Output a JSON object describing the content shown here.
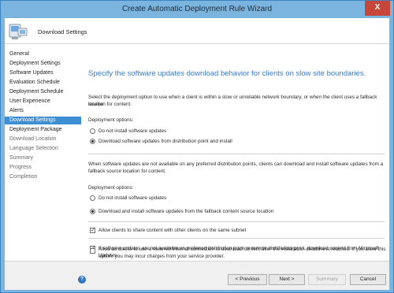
{
  "window": {
    "title": "Create Automatic Deployment Rule Wizard",
    "close_label": "X"
  },
  "header": {
    "title": "Download Settings",
    "icon": "computer-wizard-icon"
  },
  "nav": {
    "items": [
      {
        "label": "General",
        "state": "done"
      },
      {
        "label": "Deployment Settings",
        "state": "done"
      },
      {
        "label": "Software Updates",
        "state": "done"
      },
      {
        "label": "Evaluation Schedule",
        "state": "done"
      },
      {
        "label": "Deployment Schedule",
        "state": "done"
      },
      {
        "label": "User Experience",
        "state": "done"
      },
      {
        "label": "Alerts",
        "state": "done"
      },
      {
        "label": "Download Settings",
        "state": "active"
      },
      {
        "label": "Deployment Package",
        "state": "done"
      },
      {
        "label": "Download Location",
        "state": "future"
      },
      {
        "label": "Language Selection",
        "state": "future"
      },
      {
        "label": "Summary",
        "state": "future"
      },
      {
        "label": "Progress",
        "state": "future"
      },
      {
        "label": "Completion",
        "state": "future"
      }
    ]
  },
  "main": {
    "heading": "Specify the software updates download behavior for clients on slow site boundaries.",
    "section1": {
      "description_line1": "Select the deployment option to use when a client is within a slow or unreliable network boundary, or when the client uses a fallback source",
      "description_line2": "location for content.",
      "options_label": "Deployment options:",
      "option_no": "Do not install software updates",
      "option_yes": "Download software updates from distribution point and install"
    },
    "section2": {
      "description_line1": "When software updates are not available on any preferred distribution points, clients can download and install software updates from a",
      "description_line2": "fallback source location for content.",
      "options_label": "Deployment options:",
      "option_no": "Do not install software updates",
      "option_yes": "Download and install software updates from the fallback content source location"
    },
    "checks": {
      "share_content": "Allow clients to share content with other clients on the same subnet",
      "microsoft_updates": "If software updates are not available on preferred distribution point or remote distribution point, download content from Microsoft Updates.",
      "metered_line1": "Allow all clients to use a metered Internet connection to download content after the installation deadline is reached. If you allow this",
      "metered_line2": "option, you may incur charges from your service provider."
    }
  },
  "footer": {
    "help_label": "?",
    "previous_label": "< Previous",
    "next_label": "Next >",
    "summary_label": "Summary",
    "cancel_label": "Cancel"
  }
}
